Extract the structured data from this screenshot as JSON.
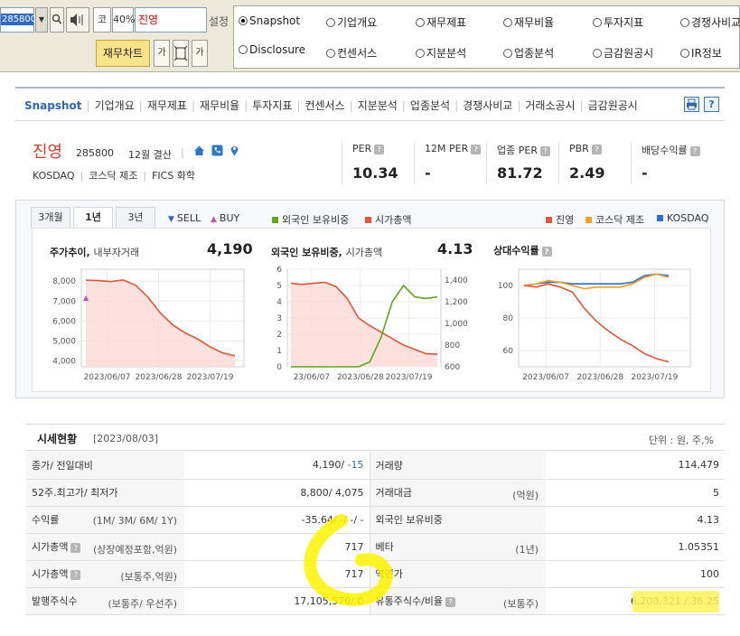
{
  "toolbar": {
    "code": "285800",
    "dropdown_glyph": "▼",
    "ko": "코",
    "zoom": "40%",
    "name": "진영",
    "setting": "설정",
    "chart_button": "재무차트",
    "small_a": "가",
    "small_b": "가",
    "radios": [
      {
        "label": "Snapshot",
        "selected": true
      },
      {
        "label": "기업개요",
        "selected": false
      },
      {
        "label": "재무제표",
        "selected": false
      },
      {
        "label": "재무비율",
        "selected": false
      },
      {
        "label": "투자지표",
        "selected": false
      },
      {
        "label": "경쟁사비교",
        "selected": false
      },
      {
        "label": "Disclosure",
        "selected": false
      },
      {
        "label": "컨센서스",
        "selected": false
      },
      {
        "label": "지분분석",
        "selected": false
      },
      {
        "label": "업종분석",
        "selected": false
      },
      {
        "label": "금감원공시",
        "selected": false
      },
      {
        "label": "IR정보",
        "selected": false
      }
    ]
  },
  "nav": {
    "items": [
      "Snapshot",
      "기업개요",
      "재무제표",
      "재무비율",
      "투자지표",
      "컨센서스",
      "지분분석",
      "업종분석",
      "경쟁사비교",
      "거래소공시",
      "금감원공시"
    ],
    "print_icon": "print-icon",
    "help_icon": "help-icon",
    "help_glyph": "?"
  },
  "company": {
    "name": "진영",
    "code": "285800",
    "fiscal": "12월 결산",
    "market": "KOSDAQ",
    "sector": "코스닥 제조",
    "fics": "FICS 화학",
    "icons": [
      "home-icon",
      "phone-icon",
      "location-icon"
    ]
  },
  "metrics": [
    {
      "label": "PER",
      "value": "10.34"
    },
    {
      "label": "12M PER",
      "value": "-"
    },
    {
      "label": "업종 PER",
      "value": "81.72"
    },
    {
      "label": "PBR",
      "value": "2.49"
    },
    {
      "label": "배당수익률",
      "value": "-"
    }
  ],
  "chart_controls": {
    "periods": [
      "3개월",
      "1년",
      "3년"
    ],
    "active_period": "1년",
    "sell": "SELL",
    "buy": "BUY",
    "legend_a": [
      "외국인 보유비중",
      "시가총액"
    ],
    "legend_b": [
      "진영",
      "코스닥 제조",
      "KOSDAQ"
    ],
    "colors": {
      "sell": "#2d66c4",
      "buy": "#c04fb3",
      "foreign": "#5fa61c",
      "mktcap": "#e0553b",
      "company": "#e0553b",
      "sector": "#f0a028",
      "kosdaq": "#2d6fc4"
    }
  },
  "chart_data": [
    {
      "type": "area",
      "title": "주가추이",
      "subtitle": "내부자거래",
      "headline": "4,190",
      "x_ticks": [
        "2023/06/07",
        "2023/06/28",
        "2023/07/19"
      ],
      "y_ticks": [
        "8,000",
        "7,000",
        "6,000",
        "5,000",
        "4,000"
      ],
      "ylim": [
        3700,
        8600
      ],
      "series": [
        {
          "values": [
            8050,
            8030,
            7980,
            8060,
            7800,
            7200,
            6400,
            5800,
            5400,
            5100,
            4700,
            4400,
            4250
          ]
        }
      ],
      "buy_marker": {
        "index": 0,
        "value": 7200
      }
    },
    {
      "type": "line",
      "title": "외국인 보유비중",
      "subtitle": "시가총액",
      "headline": "4.13",
      "x_ticks": [
        "23/06/07",
        "2023/06/28",
        "2023/07/19"
      ],
      "y_left_ticks": [
        "6",
        "5",
        "4",
        "3",
        "2",
        "1",
        "0"
      ],
      "y_right_ticks": [
        "1,400",
        "1,200",
        "1,000",
        "800",
        "600"
      ],
      "ylim_left": [
        0,
        6
      ],
      "ylim_right": [
        600,
        1500
      ],
      "series": [
        {
          "name": "외국인 보유비중",
          "axis": "left",
          "values": [
            0,
            0,
            0,
            0,
            0,
            0,
            0,
            0.3,
            1.8,
            4.0,
            5.0,
            4.3,
            4.2,
            4.3
          ]
        },
        {
          "name": "시가총액",
          "axis": "right",
          "values": [
            1370,
            1360,
            1370,
            1380,
            1340,
            1230,
            1050,
            980,
            920,
            860,
            800,
            760,
            720,
            717
          ]
        }
      ]
    },
    {
      "type": "line",
      "title": "상대수익률",
      "x_ticks": [
        "2023/06/07",
        "2023/06/28",
        "2023/07/19"
      ],
      "y_ticks": [
        "100",
        "80",
        "60"
      ],
      "ylim": [
        50,
        110
      ],
      "series": [
        {
          "name": "진영",
          "values": [
            100,
            99,
            101,
            99,
            96,
            86,
            78,
            72,
            67,
            63,
            58,
            55,
            53
          ]
        },
        {
          "name": "코스닥 제조",
          "values": [
            100,
            101,
            103,
            102,
            100,
            98,
            99,
            99,
            99,
            101,
            105,
            107,
            105
          ]
        },
        {
          "name": "KOSDAQ",
          "values": [
            100,
            101,
            102,
            102,
            101,
            101,
            101,
            101,
            101,
            102,
            106,
            107,
            106
          ]
        }
      ]
    }
  ],
  "price": {
    "title": "시세현황",
    "date": "[2023/08/03]",
    "unit": "단위 : 원, 주,%",
    "rows": [
      {
        "l1": "종가/ 전일대비",
        "h1": "",
        "v1a": "4,190/ ",
        "v1b": "-15",
        "l2": "거래량",
        "h2": "",
        "v2": "114,479"
      },
      {
        "l1": "52주.최고가/ 최저가",
        "h1": "",
        "v1a": "8,800/ 4,075",
        "v1b": "",
        "l2": "거래대금",
        "h2": "(억원)",
        "v2": "5"
      },
      {
        "l1": "수익률",
        "h1": "(1M/ 3M/ 6M/ 1Y)",
        "v1a": "-35.64/ -/ -/ -",
        "v1b": "",
        "l2": "외국인 보유비중",
        "h2": "",
        "v2": "4.13"
      },
      {
        "l1": "시가총액",
        "h1": "(상장예정포함,억원)",
        "v1a": "717",
        "v1b": "",
        "l2": "베타",
        "h2": "(1년)",
        "v2": "1.05351"
      },
      {
        "l1": "시가총액",
        "h1": "(보통주,억원)",
        "v1a": "717",
        "v1b": "",
        "l2": "액면가",
        "h2": "",
        "v2": "100"
      },
      {
        "l1": "발행주식수",
        "h1": "(보통주/ 우선주)",
        "v1a": "17,105,570/ 0",
        "v1b": "",
        "l2": "유통주식수/비율",
        "h2": "(보통주)",
        "v2": "6,200,321 / 36.25"
      }
    ]
  }
}
